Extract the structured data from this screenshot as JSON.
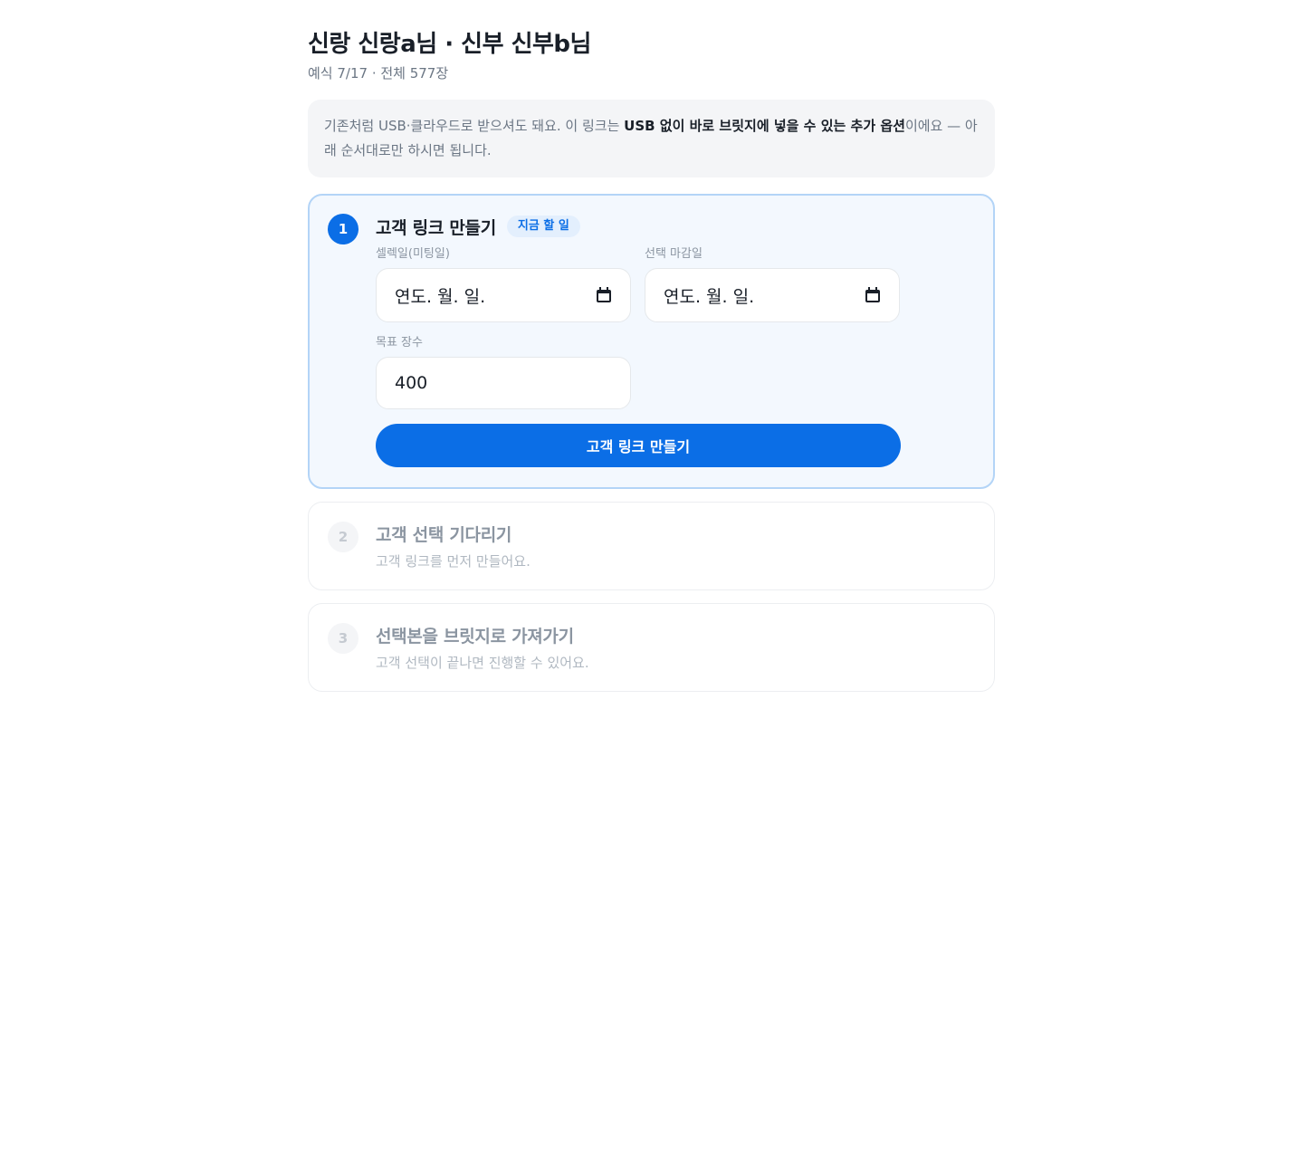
{
  "header": {
    "title": "신랑 신랑a님 · 신부 신부b님",
    "subtitle": "예식 7/17 · 전체 577장"
  },
  "notice": {
    "part1": "기존처럼 USB·클라우드로 받으셔도 돼요. 이 링크는 ",
    "bold": "USB 없이 바로 브릿지에 넣을 수 있는 추가 옵션",
    "part2": "이에요 — 아래 순서대로만 하시면 됩니다."
  },
  "steps": [
    {
      "number": "1",
      "title": "고객 링크 만들기",
      "badge": "지금 할 일",
      "fields": {
        "select_date_label": "셀렉일(미팅일)",
        "select_date_value": "연도. 월. 일.",
        "deadline_label": "선택 마감일",
        "deadline_value": "연도. 월. 일.",
        "target_label": "목표 장수",
        "target_value": "400"
      },
      "button_label": "고객 링크 만들기"
    },
    {
      "number": "2",
      "title": "고객 선택 기다리기",
      "description": "고객 링크를 먼저 만들어요."
    },
    {
      "number": "3",
      "title": "선택본을 브릿지로 가져가기",
      "description": "고객 선택이 끝나면 진행할 수 있어요."
    }
  ],
  "icons": {
    "date_picker": "calendar-icon"
  },
  "colors": {
    "primary": "#0b6ee6",
    "active_bg": "#f3f8fe",
    "active_border": "#b3d4f7",
    "badge_bg": "#e3effd"
  }
}
